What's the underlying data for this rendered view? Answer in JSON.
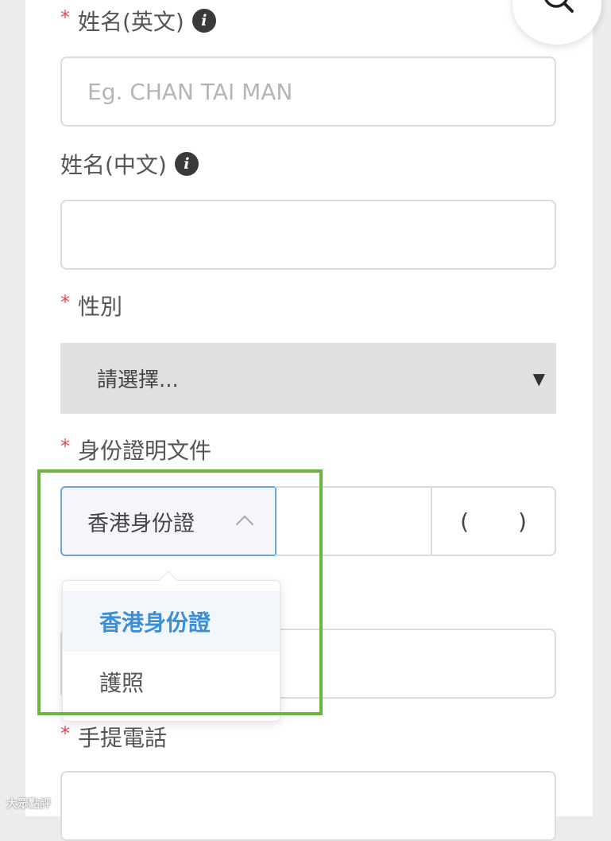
{
  "form": {
    "name_en": {
      "label": "姓名(英文)",
      "required": true,
      "info_icon": "info-icon",
      "placeholder": "Eg. CHAN TAI MAN",
      "value": ""
    },
    "name_zh": {
      "label": "姓名(中文)",
      "required": false,
      "info_icon": "info-icon",
      "placeholder": "",
      "value": ""
    },
    "gender": {
      "label": "性別",
      "required": true,
      "selected": "請選擇...",
      "arrow": "▼"
    },
    "id_document": {
      "label": "身份證明文件",
      "required": true,
      "type_selected": "香港身份證",
      "check_digit": "()",
      "dropdown_options": [
        "香港身份證",
        "護照"
      ]
    },
    "mobile": {
      "label": "手提電話",
      "required": true
    },
    "required_marker": "*"
  },
  "search_button": {
    "icon": "search-icon"
  },
  "watermark": {
    "text": "大眾點評"
  },
  "colors": {
    "required": "#e8495a",
    "accent": "#3b8ed8",
    "highlight": "#6db33f",
    "select_bg": "#e0e0e0"
  }
}
